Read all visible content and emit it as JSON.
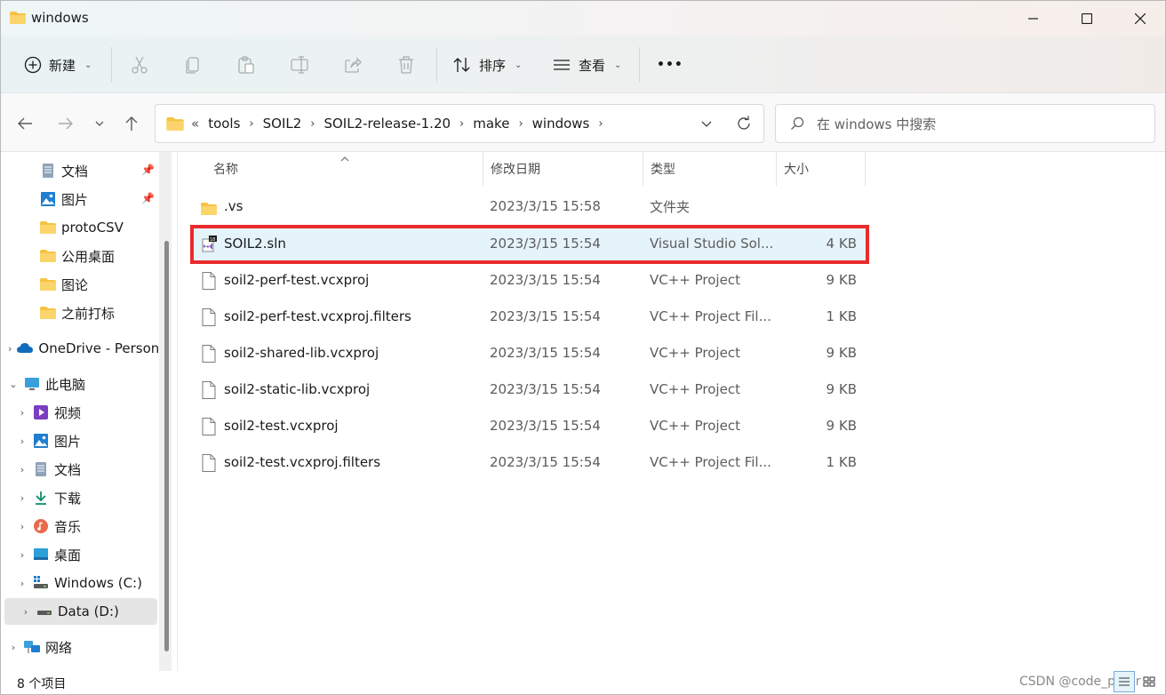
{
  "window": {
    "title": "windows"
  },
  "toolbar": {
    "new_label": "新建",
    "sort_label": "排序",
    "view_label": "查看",
    "more_label": "•••"
  },
  "address": {
    "overflow": "«",
    "crumbs": [
      "tools",
      "SOIL2",
      "SOIL2-release-1.20",
      "make",
      "windows"
    ]
  },
  "search": {
    "placeholder": "在 windows 中搜索"
  },
  "sidebar": {
    "items": [
      {
        "label": "文档",
        "pinned": true
      },
      {
        "label": "图片",
        "pinned": true
      },
      {
        "label": "protoCSV"
      },
      {
        "label": "公用桌面"
      },
      {
        "label": "图论"
      },
      {
        "label": "之前打标"
      },
      {
        "label": "OneDrive - Personal"
      },
      {
        "label": "此电脑"
      },
      {
        "label": "视频"
      },
      {
        "label": "图片"
      },
      {
        "label": "文档"
      },
      {
        "label": "下载"
      },
      {
        "label": "音乐"
      },
      {
        "label": "桌面"
      },
      {
        "label": "Windows (C:)"
      },
      {
        "label": "Data (D:)"
      },
      {
        "label": "网络"
      }
    ]
  },
  "columns": {
    "name": "名称",
    "date": "修改日期",
    "type": "类型",
    "size": "大小"
  },
  "files": [
    {
      "name": ".vs",
      "date": "2023/3/15 15:58",
      "type": "文件夹",
      "size": "",
      "icon": "folder-icon"
    },
    {
      "name": "SOIL2.sln",
      "date": "2023/3/15 15:54",
      "type": "Visual Studio Sol...",
      "size": "4 KB",
      "icon": "visual-studio-solution-icon"
    },
    {
      "name": "soil2-perf-test.vcxproj",
      "date": "2023/3/15 15:54",
      "type": "VC++ Project",
      "size": "9 KB",
      "icon": "file-icon"
    },
    {
      "name": "soil2-perf-test.vcxproj.filters",
      "date": "2023/3/15 15:54",
      "type": "VC++ Project Fil...",
      "size": "1 KB",
      "icon": "file-icon"
    },
    {
      "name": "soil2-shared-lib.vcxproj",
      "date": "2023/3/15 15:54",
      "type": "VC++ Project",
      "size": "9 KB",
      "icon": "file-icon"
    },
    {
      "name": "soil2-static-lib.vcxproj",
      "date": "2023/3/15 15:54",
      "type": "VC++ Project",
      "size": "9 KB",
      "icon": "file-icon"
    },
    {
      "name": "soil2-test.vcxproj",
      "date": "2023/3/15 15:54",
      "type": "VC++ Project",
      "size": "9 KB",
      "icon": "file-icon"
    },
    {
      "name": "soil2-test.vcxproj.filters",
      "date": "2023/3/15 15:54",
      "type": "VC++ Project Fil...",
      "size": "1 KB",
      "icon": "file-icon"
    }
  ],
  "status": {
    "count": "8 个项目",
    "watermark": "CSDN @code_peter"
  },
  "colors": {
    "folder": "#f7c244",
    "accent": "#0067c0",
    "highlight": "#ea2b2b",
    "selected_row": "#e5f3fb"
  }
}
